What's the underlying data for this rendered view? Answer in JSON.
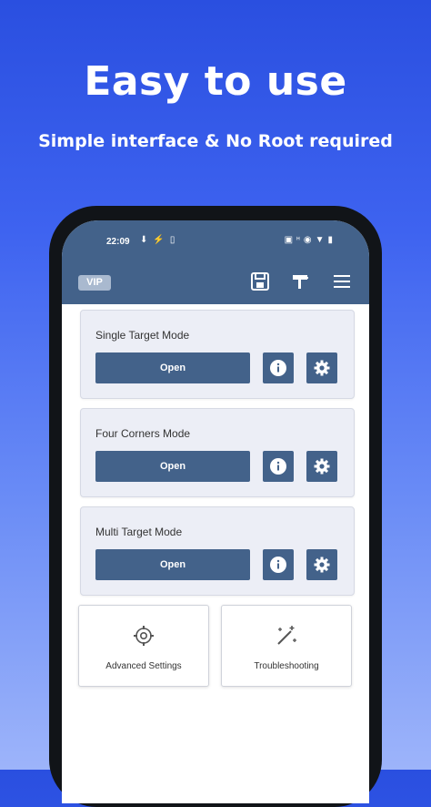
{
  "promo": {
    "headline": "Easy to use",
    "subheadline": "Simple interface & No Root required"
  },
  "statusbar": {
    "time": "22:09",
    "left_icons": [
      "download-icon",
      "signal-icon",
      "battery-saver-icon"
    ],
    "right_icons": [
      "sim-icon",
      "network-icon",
      "eye-icon",
      "wifi-icon",
      "battery-icon"
    ]
  },
  "appbar": {
    "vip_label": "VIP",
    "actions": [
      "save-icon",
      "brush-icon",
      "menu-icon"
    ]
  },
  "modes": [
    {
      "title": "Single Target Mode",
      "open_label": "Open"
    },
    {
      "title": "Four Corners Mode",
      "open_label": "Open"
    },
    {
      "title": "Multi Target Mode",
      "open_label": "Open"
    }
  ],
  "tiles": [
    {
      "label": "Advanced Settings",
      "icon": "gear-outline-icon"
    },
    {
      "label": "Troubleshooting",
      "icon": "wand-icon"
    }
  ],
  "colors": {
    "primary": "#43628a",
    "card_bg": "#eceef6",
    "bg_top": "#2a4fe0",
    "bg_bottom": "#9db4fa"
  }
}
